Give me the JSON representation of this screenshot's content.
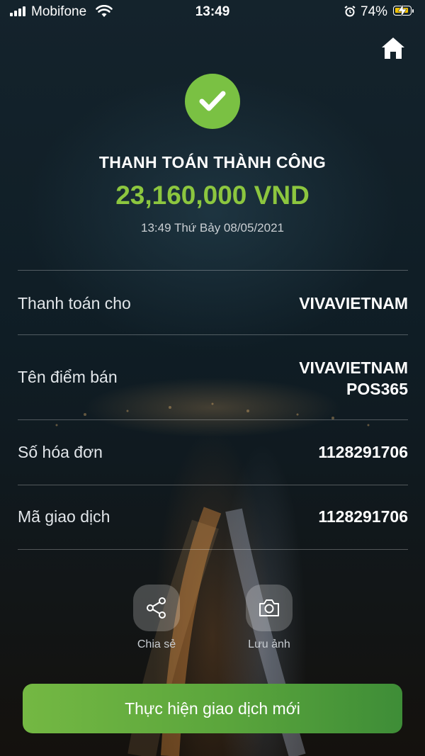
{
  "status_bar": {
    "carrier": "Mobifone",
    "time": "13:49",
    "battery_percent": "74%",
    "battery_level": 0.74
  },
  "result": {
    "title": "THANH TOÁN THÀNH CÔNG",
    "amount": "23,160,000 VND",
    "datetime": "13:49 Thứ Bảy 08/05/2021"
  },
  "details": [
    {
      "label": "Thanh toán cho",
      "value": "VIVAVIETNAM"
    },
    {
      "label": "Tên điểm bán",
      "value_line1": "VIVAVIETNAM",
      "value_line2": "POS365"
    },
    {
      "label": "Số hóa đơn",
      "value": "1128291706"
    },
    {
      "label": "Mã giao dịch",
      "value": "1128291706"
    }
  ],
  "actions": {
    "share_label": "Chia sẻ",
    "save_image_label": "Lưu ảnh"
  },
  "cta_label": "Thực hiện giao dịch mới",
  "colors": {
    "success_green": "#7ac143",
    "amount_green": "#8cc63f",
    "battery_yellow": "#f5c400"
  }
}
